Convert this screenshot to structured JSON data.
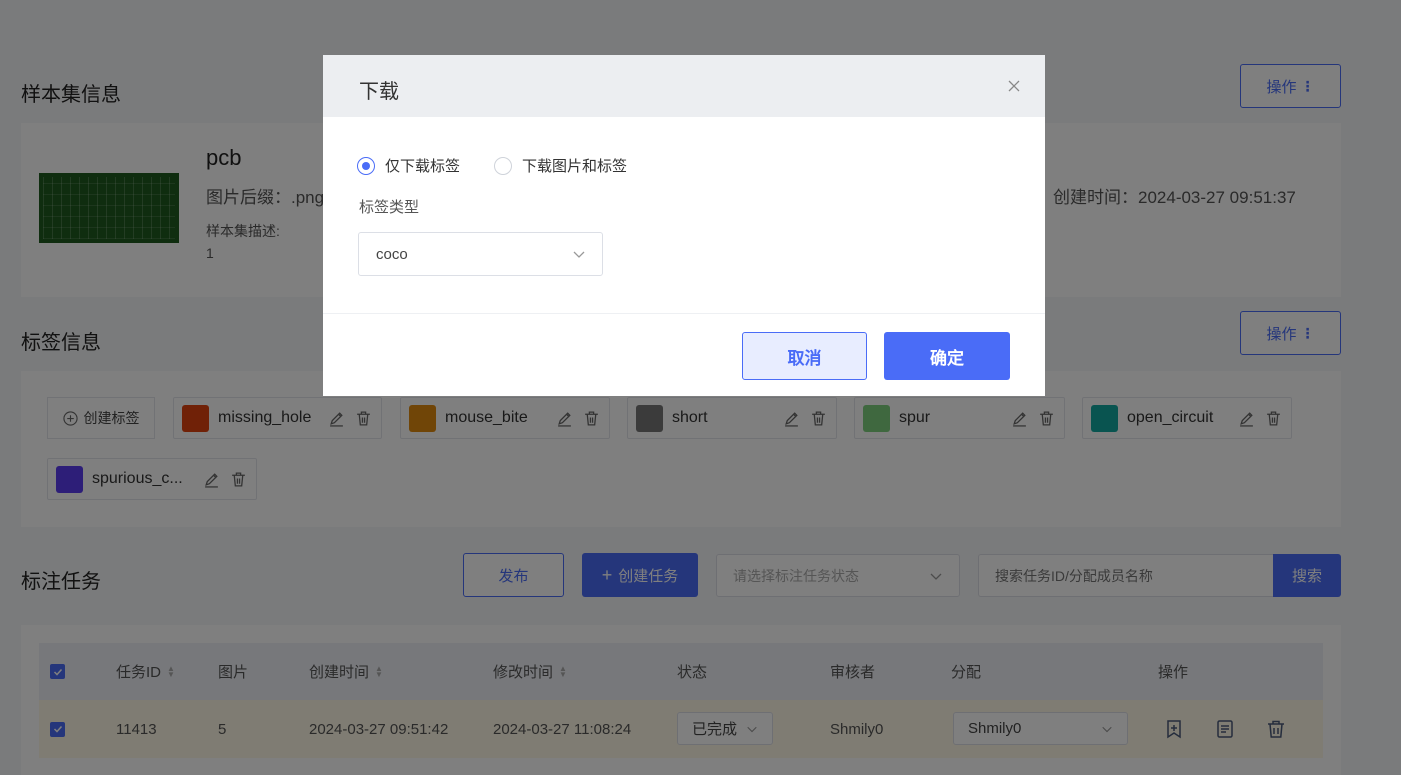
{
  "sample_section": {
    "title": "样本集信息",
    "op_label": "操作",
    "name": "pcb",
    "suffix": "图片后缀：.png",
    "desc_label": "样本集描述:",
    "desc_value": "1",
    "created_at": "创建时间：2024-03-27 09:51:37"
  },
  "label_section": {
    "title": "标签信息",
    "op_label": "操作",
    "create_label": "创建标签",
    "labels": [
      {
        "name": "missing_hole",
        "color": "#e0420f"
      },
      {
        "name": "mouse_bite",
        "color": "#e08a0f"
      },
      {
        "name": "short",
        "color": "#777777"
      },
      {
        "name": "spur",
        "color": "#7fd07f"
      },
      {
        "name": "open_circuit",
        "color": "#12a8a0"
      },
      {
        "name": "spurious_c...",
        "color": "#5a3df0"
      }
    ]
  },
  "task_section": {
    "title": "标注任务",
    "publish": "发布",
    "create_task": "创建任务",
    "status_placeholder": "请选择标注任务状态",
    "search_placeholder": "搜索任务ID/分配成员名称",
    "search": "搜索",
    "columns": {
      "id": "任务ID",
      "images": "图片",
      "created": "创建时间",
      "modified": "修改时间",
      "status": "状态",
      "reviewer": "审核者",
      "assign": "分配",
      "ops": "操作"
    },
    "rows": [
      {
        "id": "11413",
        "images": "5",
        "created": "2024-03-27 09:51:42",
        "modified": "2024-03-27 11:08:24",
        "status": "已完成",
        "reviewer": "Shmily0",
        "assign": "Shmily0"
      }
    ]
  },
  "modal": {
    "title": "下载",
    "option_labels_only": "仅下载标签",
    "option_images_and_labels": "下载图片和标签",
    "selected_option": "labels_only",
    "label_type_label": "标签类型",
    "label_type_value": "coco",
    "cancel": "取消",
    "ok": "确定"
  },
  "colors": {
    "primary": "#4a6cf7",
    "overlay": "rgba(0,0,0,0.5)"
  }
}
